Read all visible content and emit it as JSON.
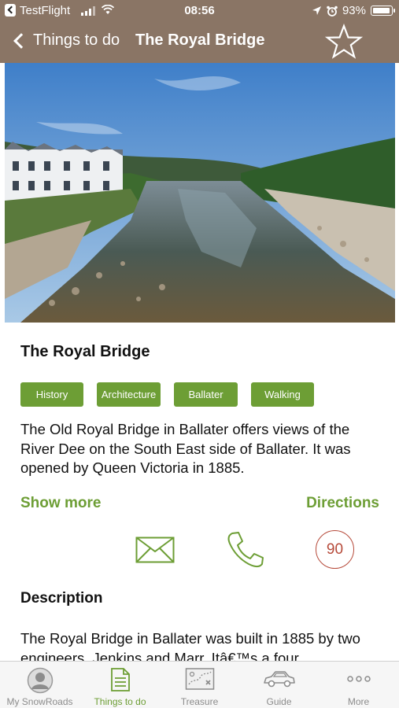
{
  "status_bar": {
    "app_name": "TestFlight",
    "time": "08:56",
    "battery": "93%"
  },
  "nav": {
    "back_label": "Things to do",
    "title": "The Royal Bridge"
  },
  "place": {
    "title": "The Royal Bridge",
    "tags": [
      "History",
      "Architecture",
      "Ballater",
      "Walking"
    ],
    "summary": "The Old Royal Bridge in Ballater offers views of the River Dee on the South East side of Ballater. It was opened by Queen Victoria in 1885.",
    "show_more": "Show more",
    "directions": "Directions",
    "badge_value": "90",
    "description_heading": "Description",
    "description": "The Royal Bridge in Ballater was built in 1885 by two engineers, Jenkins and Marr. Itâ€™s a four"
  },
  "tabs": [
    {
      "label": "My SnowRoads",
      "icon": "avatar-icon"
    },
    {
      "label": "Things to do",
      "icon": "document-icon"
    },
    {
      "label": "Treasure",
      "icon": "map-icon"
    },
    {
      "label": "Guide",
      "icon": "car-icon"
    },
    {
      "label": "More",
      "icon": "more-icon"
    }
  ],
  "colors": {
    "header": "#8a7565",
    "accent_green": "#6d9e35",
    "badge_red": "#b64a3a"
  }
}
